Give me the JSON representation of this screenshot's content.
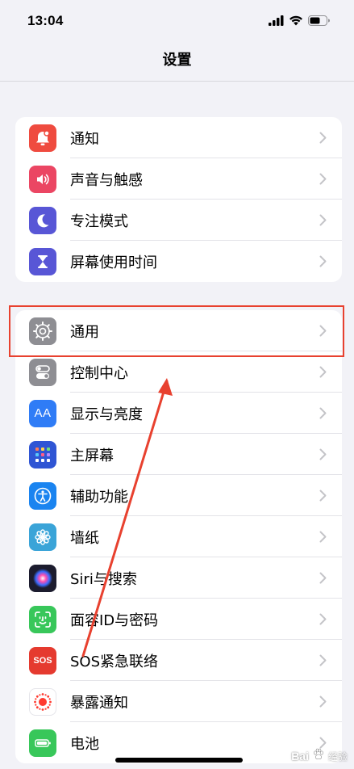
{
  "status_bar": {
    "time": "13:04",
    "signal_icon": "cellular-signal-icon",
    "wifi_icon": "wifi-icon",
    "battery_icon": "battery-icon"
  },
  "nav": {
    "title": "设置"
  },
  "groups": [
    {
      "items": [
        {
          "label": "通知",
          "icon": "notification-bell-icon",
          "color": "#ef4b3f"
        },
        {
          "label": "声音与触感",
          "icon": "speaker-icon",
          "color": "#eb4663"
        },
        {
          "label": "专注模式",
          "icon": "moon-icon",
          "color": "#5856d6"
        },
        {
          "label": "屏幕使用时间",
          "icon": "hourglass-icon",
          "color": "#5856d6"
        }
      ]
    },
    {
      "items": [
        {
          "label": "通用",
          "icon": "gear-icon",
          "color": "#8e8e93"
        },
        {
          "label": "控制中心",
          "icon": "toggle-switches-icon",
          "color": "#8e8e93"
        },
        {
          "label": "显示与亮度",
          "icon": "text-size-icon",
          "color": "#2f7cf6",
          "glyph": "AA"
        },
        {
          "label": "主屏幕",
          "icon": "app-grid-icon",
          "color": "#2f55d4"
        },
        {
          "label": "辅助功能",
          "icon": "accessibility-icon",
          "color": "#1a84f0"
        },
        {
          "label": "墙纸",
          "icon": "flower-icon",
          "color": "#3aa4d8"
        },
        {
          "label": "Siri与搜索",
          "icon": "siri-icon",
          "color": "#1c1c2e"
        },
        {
          "label": "面容ID与密码",
          "icon": "face-id-icon",
          "color": "#38c75a"
        },
        {
          "label": "SOS紧急联络",
          "icon": "sos-icon",
          "color": "#e53a2f",
          "glyph": "SOS"
        },
        {
          "label": "暴露通知",
          "icon": "exposure-icon",
          "color": "#ffffff"
        },
        {
          "label": "电池",
          "icon": "battery-app-icon",
          "color": "#38c75a"
        }
      ]
    }
  ],
  "watermark": {
    "text": "Bai",
    "logo_icon": "baidu-paw-icon",
    "suffix": "经验"
  },
  "annotation": {
    "highlight_color": "#e8412f"
  }
}
